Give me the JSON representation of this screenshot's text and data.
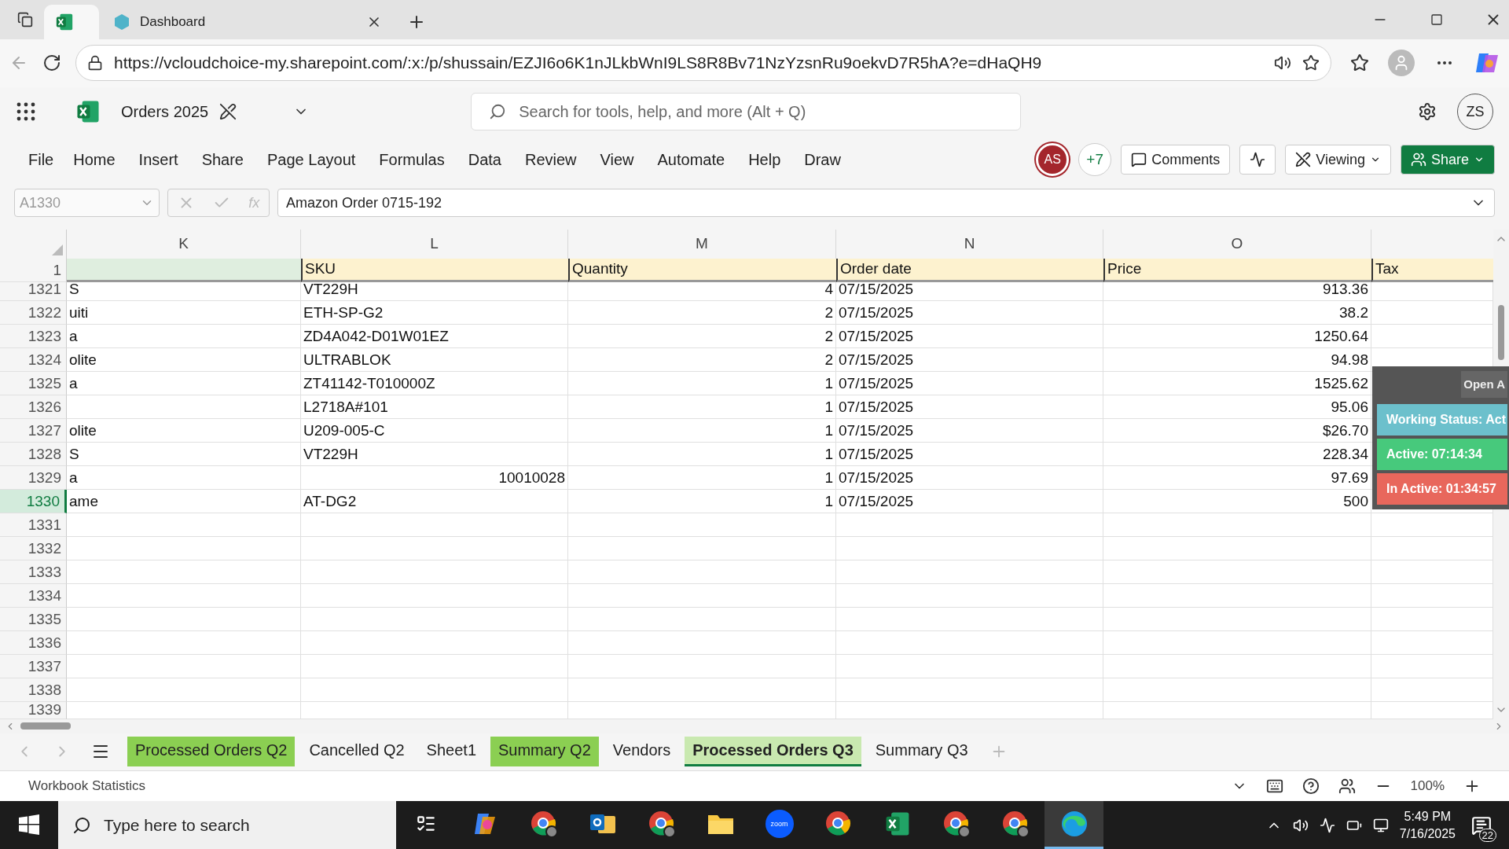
{
  "browser": {
    "tabs": [
      {
        "kind": "excel",
        "selected": true
      },
      {
        "kind": "site",
        "label": "Dashboard",
        "selected": false
      }
    ],
    "url": "https://vcloudchoice-my.sharepoint.com/:x:/p/shussain/EZJI6o6K1nJLkbWnI9LS8R8Bv71NzYzsnRu9oekvD7R5hA?e=dHaQH9"
  },
  "app": {
    "title": "Orders 2025",
    "search": {
      "placeholder": "Search for tools, help, and more (Alt + Q)"
    },
    "account": "ZS"
  },
  "menu": [
    "File",
    "Home",
    "Insert",
    "Share",
    "Page Layout",
    "Formulas",
    "Data",
    "Review",
    "View",
    "Automate",
    "Help",
    "Draw"
  ],
  "collaborators": {
    "avatar": "AS",
    "more": "+7"
  },
  "actions": {
    "comments": "Comments",
    "mode": "Viewing",
    "share": "Share"
  },
  "formula_bar": {
    "name_box": "A1330",
    "function_label": "fx",
    "value": "Amazon Order 0715-192"
  },
  "sheet": {
    "columns": [
      "K",
      "L",
      "M",
      "N",
      "O"
    ],
    "header_row": {
      "number": "1",
      "cells": [
        "",
        "SKU",
        "Quantity",
        "Order date",
        "Price",
        "Tax"
      ]
    },
    "rows": [
      {
        "number": "1321",
        "selected": false,
        "k": "S",
        "sku": "VT229H",
        "quantity": "4",
        "order_date": "07/15/2025",
        "price": "913.36"
      },
      {
        "number": "1322",
        "selected": false,
        "k": "uiti",
        "sku": "ETH-SP-G2",
        "quantity": "2",
        "order_date": "07/15/2025",
        "price": "38.2"
      },
      {
        "number": "1323",
        "selected": false,
        "k": "a",
        "sku": "ZD4A042-D01W01EZ",
        "quantity": "2",
        "order_date": "07/15/2025",
        "price": "1250.64"
      },
      {
        "number": "1324",
        "selected": false,
        "k": "olite",
        "sku": "ULTRABLOK",
        "quantity": "2",
        "order_date": "07/15/2025",
        "price": "94.98"
      },
      {
        "number": "1325",
        "selected": false,
        "k": "a",
        "sku": "ZT41142-T010000Z",
        "quantity": "1",
        "order_date": "07/15/2025",
        "price": "1525.62"
      },
      {
        "number": "1326",
        "selected": false,
        "k": "",
        "sku": "L2718A#101",
        "quantity": "1",
        "order_date": "07/15/2025",
        "price": "95.06"
      },
      {
        "number": "1327",
        "selected": false,
        "k": "olite",
        "sku": "U209-005-C",
        "quantity": "1",
        "order_date": "07/15/2025",
        "price": "$26.70"
      },
      {
        "number": "1328",
        "selected": false,
        "k": "S",
        "sku": "VT229H",
        "quantity": "1",
        "order_date": "07/15/2025",
        "price": "228.34"
      },
      {
        "number": "1329",
        "selected": false,
        "k": "a",
        "sku": "10010028",
        "sku_numeric": true,
        "quantity": "1",
        "order_date": "07/15/2025",
        "price": "97.69"
      },
      {
        "number": "1330",
        "selected": true,
        "k": "ame",
        "sku": "AT-DG2",
        "quantity": "1",
        "order_date": "07/15/2025",
        "price": "500"
      }
    ],
    "empty_rows": [
      "1331",
      "1332",
      "1333",
      "1334",
      "1335",
      "1336",
      "1337",
      "1338",
      "1339"
    ]
  },
  "tracker": {
    "button": "Open A",
    "lines": [
      {
        "text": "Working Status: Act",
        "color": "#6cc0cc"
      },
      {
        "text": "Active: 07:14:34",
        "color": "#47c97c"
      },
      {
        "text": "In Active: 01:34:57",
        "color": "#e8675c"
      }
    ]
  },
  "sheet_tabs": [
    {
      "label": "Processed Orders Q2",
      "selected": false,
      "color": "#8bcf52"
    },
    {
      "label": "Cancelled Q2",
      "selected": false
    },
    {
      "label": "Sheet1",
      "selected": false
    },
    {
      "label": "Summary Q2",
      "selected": false,
      "color": "#8bcf52"
    },
    {
      "label": "Vendors",
      "selected": false
    },
    {
      "label": "Processed Orders Q3",
      "selected": true,
      "color": "#c9e9b0"
    },
    {
      "label": "Summary Q3",
      "selected": false
    }
  ],
  "status_bar": {
    "label": "Workbook Statistics",
    "zoom": "100%"
  },
  "taskbar": {
    "search": {
      "placeholder": "Type here to search"
    },
    "apps": [
      {
        "kind": "task-view",
        "selected": false
      },
      {
        "kind": "copilot",
        "selected": false
      },
      {
        "kind": "chrome-profile",
        "selected": false
      },
      {
        "kind": "outlook",
        "selected": false
      },
      {
        "kind": "chrome-profile",
        "selected": false
      },
      {
        "kind": "folder",
        "selected": false
      },
      {
        "kind": "zoom",
        "label": "zoom",
        "selected": false
      },
      {
        "kind": "chrome",
        "selected": false
      },
      {
        "kind": "excel",
        "selected": false
      },
      {
        "kind": "chrome-profile",
        "selected": false
      },
      {
        "kind": "chrome-profile",
        "selected": false
      },
      {
        "kind": "edge",
        "selected": true
      }
    ],
    "time": "5:49 PM",
    "date": "7/16/2025",
    "notifications": "22"
  }
}
